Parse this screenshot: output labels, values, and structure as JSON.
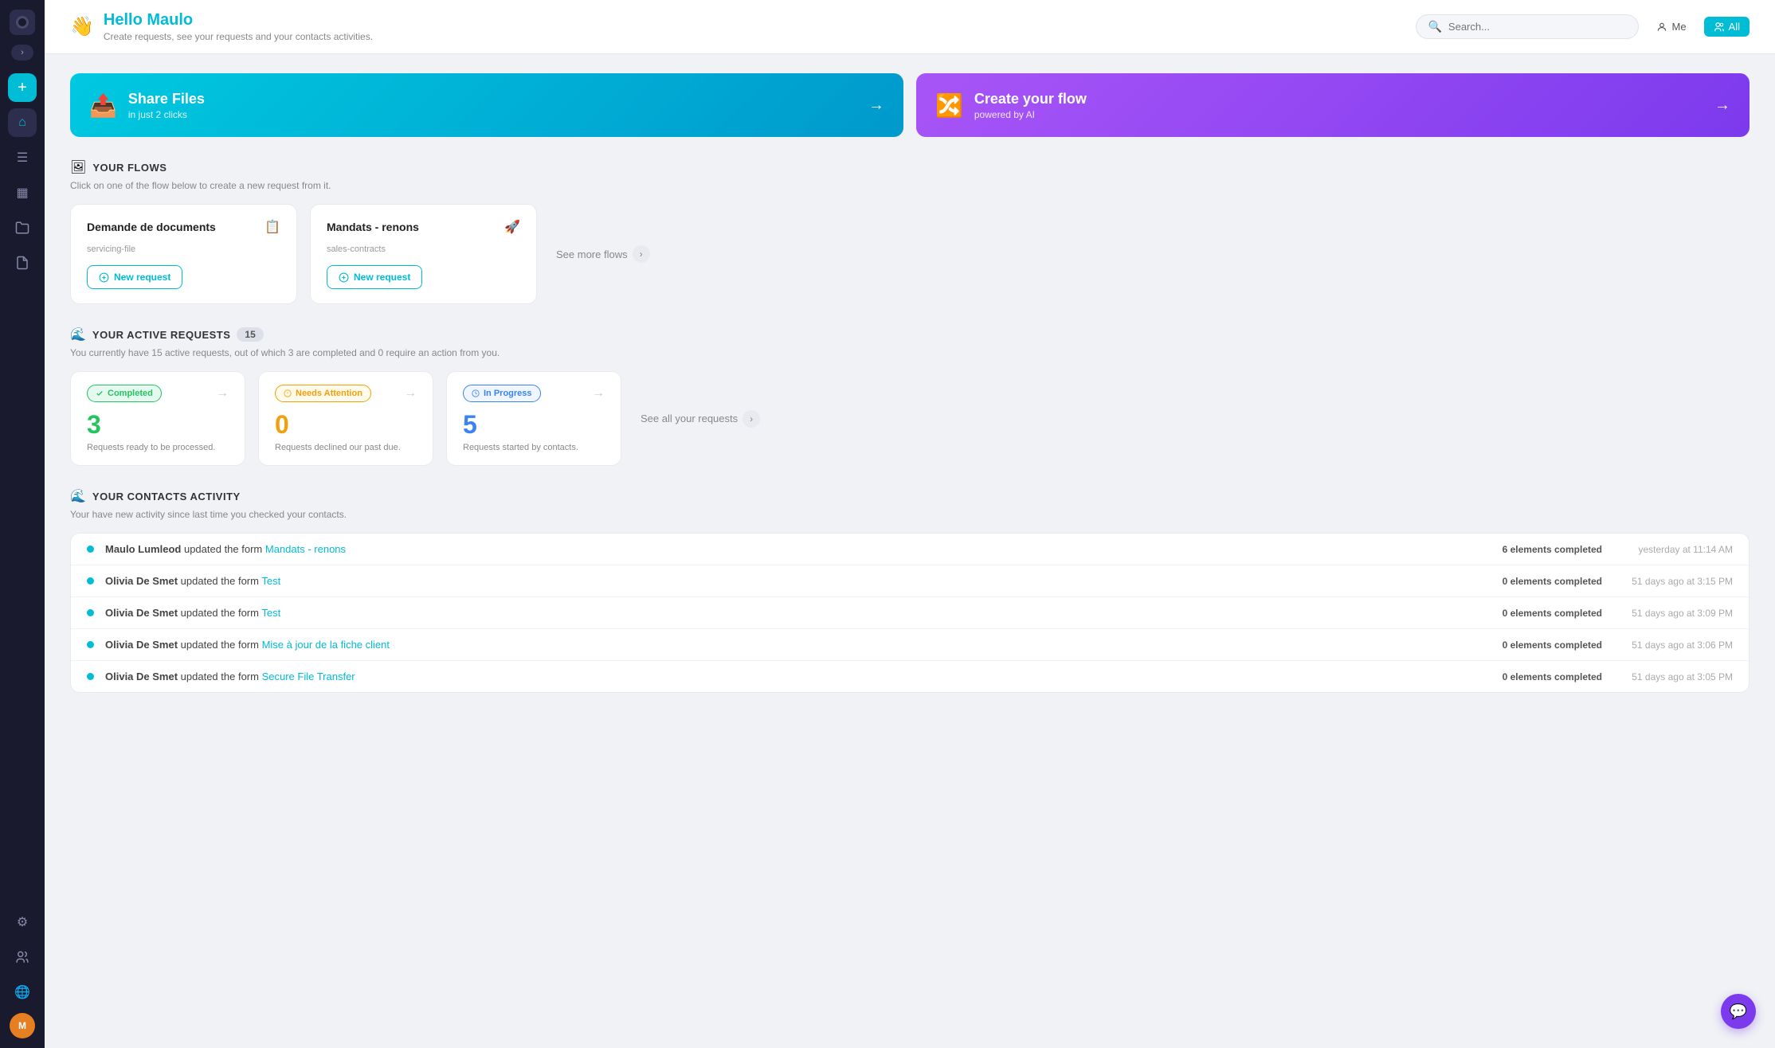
{
  "sidebar": {
    "logo_initial": "●",
    "collapse_icon": "›",
    "add_label": "+",
    "nav_items": [
      {
        "id": "home",
        "icon": "⌂",
        "active": true
      },
      {
        "id": "list",
        "icon": "☰",
        "active": false
      },
      {
        "id": "grid",
        "icon": "▦",
        "active": false
      },
      {
        "id": "folder",
        "icon": "📁",
        "active": false
      },
      {
        "id": "doc",
        "icon": "📄",
        "active": false
      }
    ],
    "bottom_items": [
      {
        "id": "settings",
        "icon": "⚙"
      },
      {
        "id": "users",
        "icon": "👥"
      },
      {
        "id": "globe",
        "icon": "🌐"
      }
    ],
    "avatar_initial": "M"
  },
  "header": {
    "wave_emoji": "👋",
    "title": "Hello Maulo",
    "subtitle": "Create requests, see your requests and your contacts activities.",
    "search_placeholder": "Search...",
    "me_label": "Me",
    "all_label": "All"
  },
  "promo": {
    "cards": [
      {
        "id": "share-files",
        "title": "Share Files",
        "subtitle": "in just 2 clicks",
        "icon": "📤",
        "arrow": "→",
        "style": "blue"
      },
      {
        "id": "create-flow",
        "title": "Create your flow",
        "subtitle": "powered by AI",
        "icon": "🔀",
        "arrow": "→",
        "style": "purple"
      }
    ]
  },
  "flows": {
    "section_icon": "🖼",
    "section_title": "YOUR FLOWS",
    "section_sub": "Click on one of the flow below to create a new request from it.",
    "items": [
      {
        "title": "Demande de documents",
        "tag": "servicing-file",
        "icon_emoji": "📋",
        "new_request_label": "New request"
      },
      {
        "title": "Mandats - renons",
        "tag": "sales-contracts",
        "icon_emoji": "🚀",
        "new_request_label": "New request"
      }
    ],
    "see_more_label": "See more flows"
  },
  "active_requests": {
    "section_icon": "🌊",
    "section_title": "YOUR ACTIVE REQUESTS",
    "badge_count": "15",
    "sub_text": "You currently have 15 active requests, out of which 3 are completed and 0 require an action from you.",
    "stats": [
      {
        "id": "completed",
        "badge_label": "Completed",
        "badge_style": "completed",
        "number": "3",
        "number_style": "blue",
        "description": "Requests ready to be processed."
      },
      {
        "id": "needs-attention",
        "badge_label": "Needs Attention",
        "badge_style": "attention",
        "number": "0",
        "number_style": "orange",
        "description": "Requests declined our past due."
      },
      {
        "id": "in-progress",
        "badge_label": "In Progress",
        "badge_style": "progress",
        "number": "5",
        "number_style": "cyan",
        "description": "Requests started by contacts."
      }
    ],
    "see_all_label": "See all your requests"
  },
  "contacts_activity": {
    "section_icon": "🌊",
    "section_title": "YOUR CONTACTS ACTIVITY",
    "section_sub": "Your have new activity since last time you checked your contacts.",
    "activities": [
      {
        "person": "Maulo Lumleod",
        "action": "updated the form",
        "link_text": "Mandats - renons",
        "elements_count": "6 elements completed",
        "time": "yesterday at 11:14 AM"
      },
      {
        "person": "Olivia De Smet",
        "action": "updated the form",
        "link_text": "Test",
        "elements_count": "0 elements completed",
        "time": "51 days ago at 3:15 PM"
      },
      {
        "person": "Olivia De Smet",
        "action": "updated the form",
        "link_text": "Test",
        "elements_count": "0 elements completed",
        "time": "51 days ago at 3:09 PM"
      },
      {
        "person": "Olivia De Smet",
        "action": "updated the form",
        "link_text": "Mise à jour de la fiche client",
        "elements_count": "0 elements completed",
        "time": "51 days ago at 3:06 PM"
      },
      {
        "person": "Olivia De Smet",
        "action": "updated the form",
        "link_text": "Secure File Transfer",
        "elements_count": "0 elements completed",
        "time": "51 days ago at 3:05 PM"
      }
    ]
  },
  "chat_icon": "💬"
}
